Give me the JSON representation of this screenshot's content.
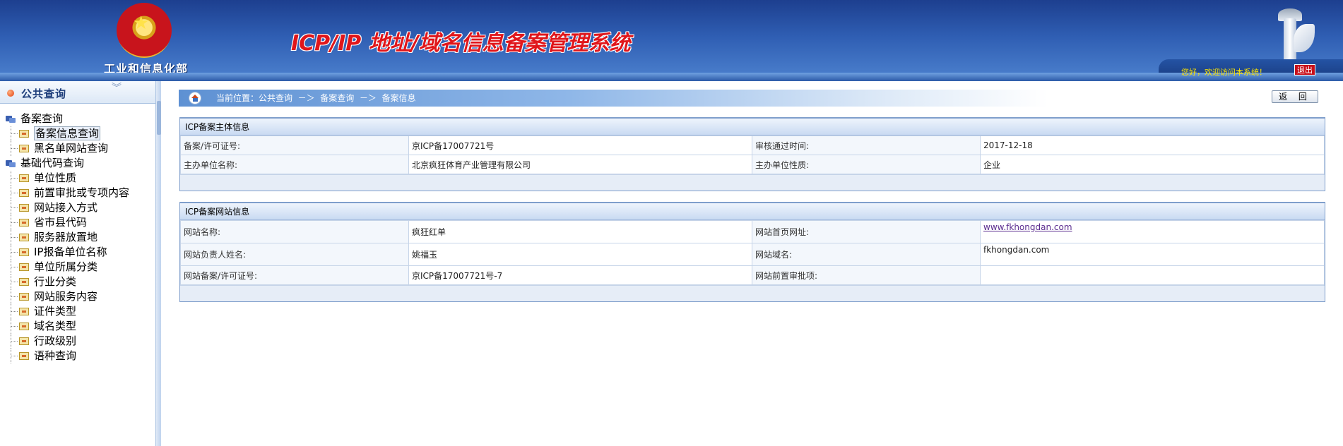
{
  "header": {
    "ministry": "工业和信息化部",
    "system_title": "ICP/IP 地址/域名信息备案管理系统",
    "welcome": "您好，欢迎访问本系统！",
    "logout": "退出",
    "emblem_star": "★"
  },
  "sidebar": {
    "title": "公共查询",
    "chevron": "︾",
    "groups": [
      {
        "label": "备案查询",
        "items": [
          "备案信息查询",
          "黑名单网站查询"
        ]
      },
      {
        "label": "基础代码查询",
        "items": [
          "单位性质",
          "前置审批或专项内容",
          "网站接入方式",
          "省市县代码",
          "服务器放置地",
          "IP报备单位名称",
          "单位所属分类",
          "行业分类",
          "网站服务内容",
          "证件类型",
          "域名类型",
          "行政级别",
          "语种查询"
        ]
      }
    ]
  },
  "breadcrumb": {
    "text": "当前位置：公共查询  －＞  备案查询  －＞  备案信息"
  },
  "back_button": "返 回",
  "subject_panel": {
    "title": "ICP备案主体信息",
    "rows": [
      {
        "k1": "备案/许可证号:",
        "v1": "京ICP备17007721号",
        "k2": "审核通过时间:",
        "v2": "2017-12-18"
      },
      {
        "k1": "主办单位名称:",
        "v1": "北京疯狂体育产业管理有限公司",
        "k2": "主办单位性质:",
        "v2": "企业"
      }
    ]
  },
  "site_panel": {
    "title": "ICP备案网站信息",
    "rows": [
      {
        "k1": "网站名称:",
        "v1": "疯狂红单",
        "k2": "网站首页网址:",
        "v2": "www.fkhongdan.com"
      },
      {
        "k1": "网站负责人姓名:",
        "v1": "姚福玉",
        "k2": "网站域名:",
        "v2": "fkhongdan.com"
      },
      {
        "k1": "网站备案/许可证号:",
        "v1": "京ICP备17007721号-7",
        "k2": "网站前置审批项:",
        "v2": ""
      }
    ]
  }
}
